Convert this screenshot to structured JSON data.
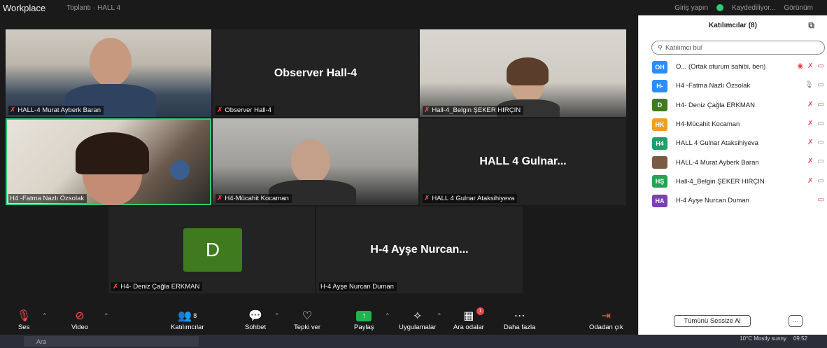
{
  "titlebar": {
    "app_name": "Workplace",
    "meeting_title": "Toplantı · HALL 4",
    "sign_in": "Giriş yapın",
    "recording": "Kaydediliyor...",
    "view": "Görünüm"
  },
  "tiles": [
    {
      "id": "murat",
      "label": "HALL-4 Murat Ayberk Baran",
      "center": ""
    },
    {
      "id": "observer",
      "label": "Observer Hall-4",
      "center": "Observer Hall-4"
    },
    {
      "id": "belgin",
      "label": "Hall-4_Belgin ŞEKER HIRÇIN",
      "center": ""
    },
    {
      "id": "fatma",
      "label": "H4 -Fatma Nazlı Özsolak",
      "center": ""
    },
    {
      "id": "mucahit",
      "label": "H4-Mücahit Kocaman",
      "center": ""
    },
    {
      "id": "gulnar",
      "label": "HALL 4  Gulnar Ataksihiyeva",
      "center": "HALL 4   Gulnar..."
    },
    {
      "id": "deniz",
      "label": "H4- Deniz Çağla ERKMAN",
      "center": ""
    },
    {
      "id": "ayse",
      "label": "H-4 Ayşe Nurcan Duman",
      "center": "H-4 Ayşe Nurcan..."
    }
  ],
  "avatar_letter": "D",
  "toolbar": {
    "audio": "Ses",
    "video": "Video",
    "participants": "Katılımcılar",
    "participants_count": "8",
    "chat": "Sohbet",
    "reactions": "Tepki ver",
    "share": "Paylaş",
    "apps": "Uygulamalar",
    "breakout": "Ara odalar",
    "breakout_badge": "1",
    "more": "Daha fazla",
    "leave": "Odadan çık"
  },
  "panel": {
    "title": "Katılımcılar (8)",
    "search_placeholder": "Katılımcı bul",
    "mute_all": "Tümünü Sessize Al",
    "more": "···",
    "participants": [
      {
        "initials": "OH",
        "name": "O... (Ortak oturum sahibi, ben)",
        "color": "#2d8cff"
      },
      {
        "initials": "H-",
        "name": "H4 -Fatma Nazlı Özsolak",
        "color": "#2d8cff"
      },
      {
        "initials": "D",
        "name": "H4- Deniz Çağla ERKMAN",
        "color": "#3f7a1e"
      },
      {
        "initials": "HK",
        "name": "H4-Mücahit Kocaman",
        "color": "#f29d1e"
      },
      {
        "initials": "H4",
        "name": "HALL 4  Gulnar Ataksihiyeva",
        "color": "#1d9e6e"
      },
      {
        "initials": "",
        "name": "HALL-4 Murat Ayberk Baran",
        "color": "#7a5a44"
      },
      {
        "initials": "HŞ",
        "name": "Hall-4_Belgin ŞEKER HIRÇIN",
        "color": "#23a455"
      },
      {
        "initials": "HA",
        "name": "H-4 Ayşe Nurcan Duman",
        "color": "#7b3fb8"
      }
    ]
  },
  "taskbar": {
    "search": "Ara",
    "weather": "10°C Mostly sunny",
    "time": "09:52"
  }
}
